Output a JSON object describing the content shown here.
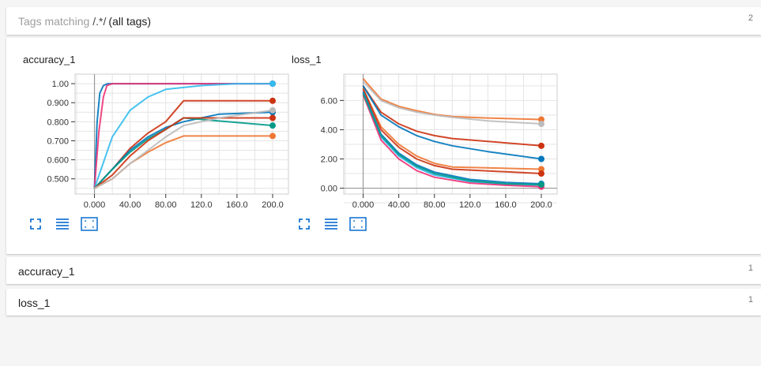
{
  "header_pane": {
    "prefix": "Tags matching",
    "regex": "/.*/",
    "suffix": "(all tags)",
    "count": "2"
  },
  "cards": [
    {
      "title": "accuracy_1"
    },
    {
      "title": "loss_1"
    }
  ],
  "collapsed_panes": [
    {
      "title": "accuracy_1",
      "count": "1"
    },
    {
      "title": "loss_1",
      "count": "1"
    }
  ],
  "icons": [
    "fullscreen-icon",
    "toggle-log-scale-icon",
    "fit-domain-icon"
  ],
  "colors": {
    "accent": "#1976d2",
    "series": [
      "#0077bb",
      "#33bbee",
      "#ee3377",
      "#cc3311",
      "#ee7733",
      "#009988",
      "#bbbbbb"
    ]
  },
  "chart_data": [
    {
      "type": "line",
      "title": "accuracy_1",
      "xlim": [
        0,
        200
      ],
      "ylim": [
        0.42,
        1.05
      ],
      "x_ticks": [
        "0.000",
        "40.00",
        "80.00",
        "120.0",
        "160.0",
        "200.0"
      ],
      "y_ticks": [
        "0.500",
        "0.600",
        "0.700",
        "0.800",
        "0.900",
        "1.00"
      ],
      "grid": true,
      "series": [
        {
          "color": "#0077bb",
          "x": [
            0,
            3,
            6,
            10,
            15,
            200
          ],
          "y": [
            0.45,
            0.8,
            0.95,
            0.99,
            1.0,
            1.0
          ]
        },
        {
          "color": "#ee3377",
          "x": [
            0,
            5,
            10,
            14,
            20,
            200
          ],
          "y": [
            0.45,
            0.75,
            0.93,
            0.99,
            1.0,
            1.0
          ]
        },
        {
          "color": "#33bbee",
          "x": [
            0,
            20,
            40,
            60,
            80,
            120,
            160,
            200
          ],
          "y": [
            0.45,
            0.72,
            0.86,
            0.93,
            0.97,
            0.99,
            1.0,
            1.0
          ]
        },
        {
          "color": "#cc3311",
          "x": [
            0,
            20,
            40,
            60,
            80,
            100,
            200
          ],
          "y": [
            0.45,
            0.55,
            0.66,
            0.74,
            0.8,
            0.91,
            0.91
          ]
        },
        {
          "color": "#0077bb",
          "x": [
            0,
            20,
            40,
            60,
            80,
            100,
            140,
            200
          ],
          "y": [
            0.45,
            0.55,
            0.65,
            0.72,
            0.77,
            0.8,
            0.84,
            0.85
          ]
        },
        {
          "color": "#009988",
          "x": [
            0,
            20,
            40,
            60,
            80,
            100,
            200
          ],
          "y": [
            0.45,
            0.55,
            0.64,
            0.71,
            0.76,
            0.82,
            0.78
          ]
        },
        {
          "color": "#cc3311",
          "x": [
            0,
            20,
            40,
            60,
            80,
            100,
            200
          ],
          "y": [
            0.45,
            0.52,
            0.62,
            0.7,
            0.76,
            0.82,
            0.82
          ]
        },
        {
          "color": "#ee7733",
          "x": [
            0,
            20,
            40,
            60,
            80,
            100,
            200
          ],
          "y": [
            0.45,
            0.5,
            0.58,
            0.64,
            0.69,
            0.725,
            0.725
          ]
        },
        {
          "color": "#bbbbbb",
          "x": [
            0,
            20,
            40,
            60,
            80,
            100,
            140,
            200
          ],
          "y": [
            0.45,
            0.5,
            0.58,
            0.65,
            0.72,
            0.78,
            0.82,
            0.86
          ]
        }
      ]
    },
    {
      "type": "line",
      "title": "loss_1",
      "xlim": [
        0,
        200
      ],
      "ylim": [
        -0.4,
        7.8
      ],
      "x_ticks": [
        "0.000",
        "40.00",
        "80.00",
        "120.0",
        "160.0",
        "200.0"
      ],
      "y_ticks": [
        "0.00",
        "2.00",
        "4.00",
        "6.00"
      ],
      "grid": true,
      "series": [
        {
          "color": "#ee7733",
          "x": [
            0,
            20,
            40,
            60,
            80,
            100,
            140,
            200
          ],
          "y": [
            7.5,
            6.1,
            5.6,
            5.3,
            5.05,
            4.9,
            4.8,
            4.7
          ]
        },
        {
          "color": "#bbbbbb",
          "x": [
            0,
            20,
            40,
            60,
            80,
            100,
            140,
            200
          ],
          "y": [
            7.3,
            6.0,
            5.5,
            5.2,
            5.0,
            4.85,
            4.6,
            4.4
          ]
        },
        {
          "color": "#cc3311",
          "x": [
            0,
            20,
            40,
            60,
            80,
            100,
            200
          ],
          "y": [
            7.0,
            5.2,
            4.4,
            3.9,
            3.6,
            3.4,
            2.9
          ]
        },
        {
          "color": "#0077bb",
          "x": [
            0,
            20,
            40,
            60,
            80,
            100,
            140,
            200
          ],
          "y": [
            7.0,
            5.0,
            4.2,
            3.6,
            3.2,
            2.9,
            2.5,
            2.0
          ]
        },
        {
          "color": "#ee7733",
          "x": [
            0,
            20,
            40,
            60,
            80,
            100,
            200
          ],
          "y": [
            6.8,
            4.2,
            3.0,
            2.2,
            1.7,
            1.45,
            1.3
          ]
        },
        {
          "color": "#cc3311",
          "x": [
            0,
            20,
            40,
            60,
            80,
            100,
            200
          ],
          "y": [
            6.8,
            4.0,
            2.8,
            2.0,
            1.55,
            1.3,
            1.0
          ]
        },
        {
          "color": "#0077bb",
          "x": [
            0,
            20,
            40,
            60,
            80,
            120,
            160,
            200
          ],
          "y": [
            6.6,
            3.7,
            2.4,
            1.6,
            1.1,
            0.6,
            0.4,
            0.3
          ]
        },
        {
          "color": "#33bbee",
          "x": [
            0,
            20,
            40,
            60,
            80,
            120,
            160,
            200
          ],
          "y": [
            6.5,
            3.5,
            2.2,
            1.4,
            0.9,
            0.45,
            0.25,
            0.2
          ]
        },
        {
          "color": "#ee3377",
          "x": [
            0,
            20,
            40,
            60,
            80,
            120,
            160,
            200
          ],
          "y": [
            6.4,
            3.3,
            2.0,
            1.2,
            0.75,
            0.35,
            0.2,
            0.1
          ]
        },
        {
          "color": "#009988",
          "x": [
            0,
            20,
            40,
            60,
            80,
            120,
            160,
            200
          ],
          "y": [
            6.5,
            3.6,
            2.3,
            1.5,
            1.0,
            0.5,
            0.3,
            0.25
          ]
        }
      ]
    }
  ]
}
